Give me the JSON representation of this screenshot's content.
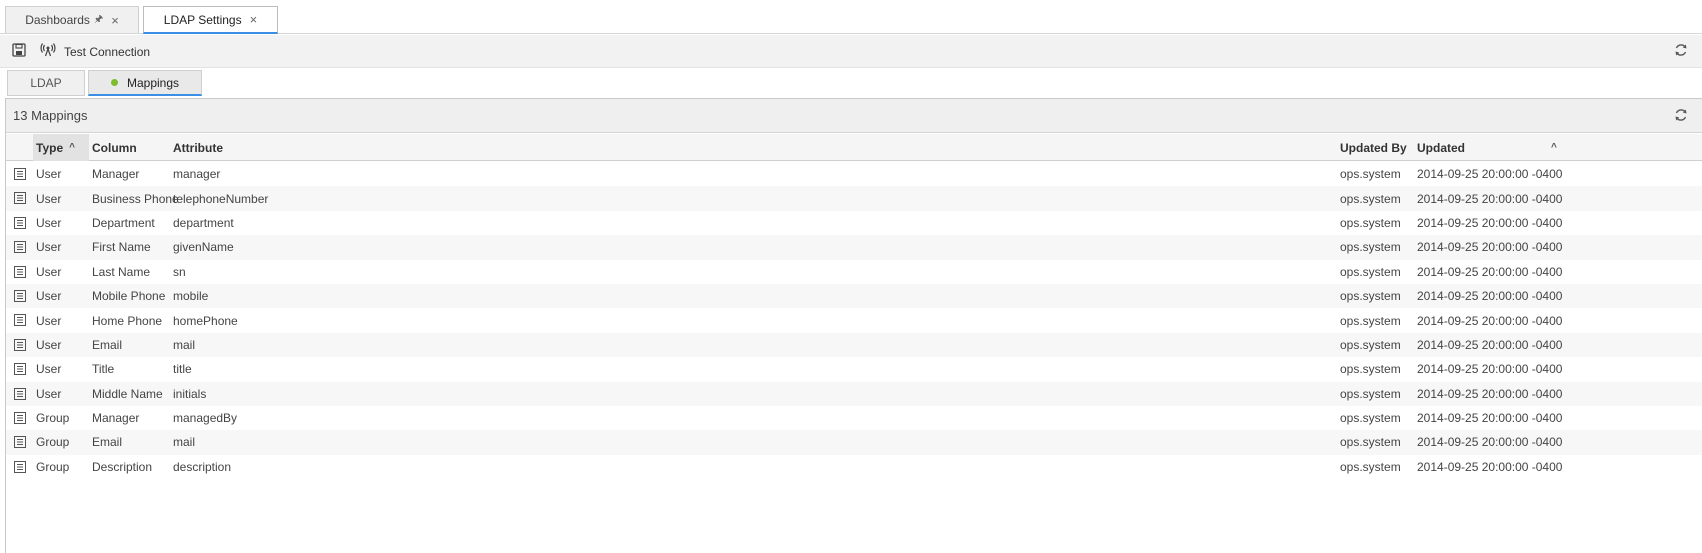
{
  "doc_tabs": [
    {
      "label": "Dashboards"
    },
    {
      "label": "LDAP Settings"
    }
  ],
  "toolbar": {
    "test_connection_label": "Test Connection"
  },
  "sub_tabs": [
    {
      "label": "LDAP"
    },
    {
      "label": "Mappings"
    }
  ],
  "panel": {
    "title": "13 Mappings"
  },
  "columns": {
    "type": "Type",
    "column": "Column",
    "attribute": "Attribute",
    "updated_by": "Updated By",
    "updated": "Updated"
  },
  "rows": [
    {
      "type": "User",
      "column": "Manager",
      "attribute": "manager",
      "updated_by": "ops.system",
      "updated": "2014-09-25 20:00:00 -0400"
    },
    {
      "type": "User",
      "column": "Business Phone",
      "attribute": "telephoneNumber",
      "updated_by": "ops.system",
      "updated": "2014-09-25 20:00:00 -0400"
    },
    {
      "type": "User",
      "column": "Department",
      "attribute": "department",
      "updated_by": "ops.system",
      "updated": "2014-09-25 20:00:00 -0400"
    },
    {
      "type": "User",
      "column": "First Name",
      "attribute": "givenName",
      "updated_by": "ops.system",
      "updated": "2014-09-25 20:00:00 -0400"
    },
    {
      "type": "User",
      "column": "Last Name",
      "attribute": "sn",
      "updated_by": "ops.system",
      "updated": "2014-09-25 20:00:00 -0400"
    },
    {
      "type": "User",
      "column": "Mobile Phone",
      "attribute": "mobile",
      "updated_by": "ops.system",
      "updated": "2014-09-25 20:00:00 -0400"
    },
    {
      "type": "User",
      "column": "Home Phone",
      "attribute": "homePhone",
      "updated_by": "ops.system",
      "updated": "2014-09-25 20:00:00 -0400"
    },
    {
      "type": "User",
      "column": "Email",
      "attribute": "mail",
      "updated_by": "ops.system",
      "updated": "2014-09-25 20:00:00 -0400"
    },
    {
      "type": "User",
      "column": "Title",
      "attribute": "title",
      "updated_by": "ops.system",
      "updated": "2014-09-25 20:00:00 -0400"
    },
    {
      "type": "User",
      "column": "Middle Name",
      "attribute": "initials",
      "updated_by": "ops.system",
      "updated": "2014-09-25 20:00:00 -0400"
    },
    {
      "type": "Group",
      "column": "Manager",
      "attribute": "managedBy",
      "updated_by": "ops.system",
      "updated": "2014-09-25 20:00:00 -0400"
    },
    {
      "type": "Group",
      "column": "Email",
      "attribute": "mail",
      "updated_by": "ops.system",
      "updated": "2014-09-25 20:00:00 -0400"
    },
    {
      "type": "Group",
      "column": "Description",
      "attribute": "description",
      "updated_by": "ops.system",
      "updated": "2014-09-25 20:00:00 -0400"
    }
  ],
  "icons": {
    "pin": "pin-icon",
    "close": "close-icon",
    "save": "save-icon",
    "test_connection": "antenna-icon",
    "refresh": "refresh-icon",
    "row_detail": "detail-list-icon",
    "sort": "sort-ascending-icon"
  },
  "colors": {
    "accent": "#3a8ee6",
    "status_dot": "#7dbb2f"
  }
}
